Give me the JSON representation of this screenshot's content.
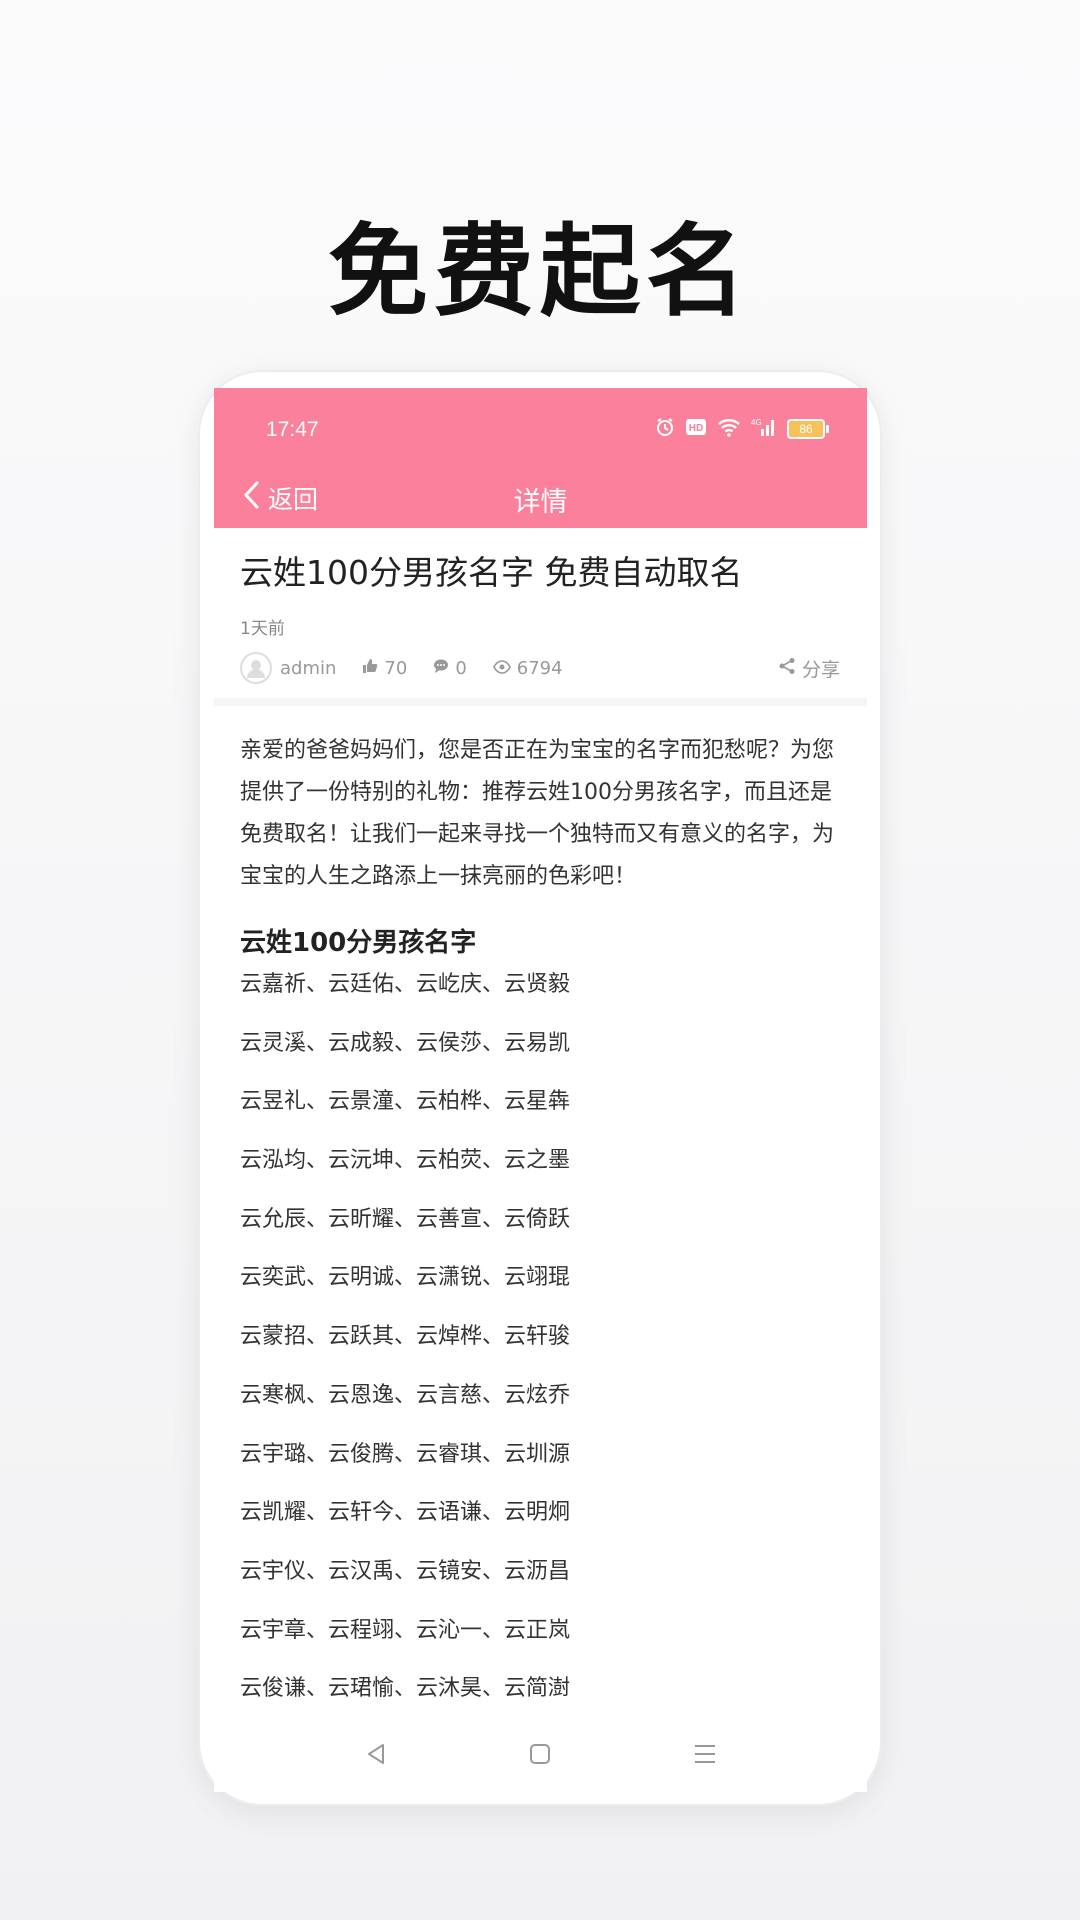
{
  "promo": {
    "title": "免费起名"
  },
  "status_bar": {
    "time": "17:47",
    "battery": "86"
  },
  "navbar": {
    "back_label": "返回",
    "title": "详情"
  },
  "article": {
    "title": "云姓100分男孩名字 免费自动取名",
    "time": "1天前",
    "author": "admin",
    "likes": "70",
    "comments": "0",
    "views": "6794",
    "share_label": "分享",
    "intro": "亲爱的爸爸妈妈们，您是否正在为宝宝的名字而犯愁呢？为您提供了一份特别的礼物：推荐云姓100分男孩名字，而且还是免费取名！让我们一起来寻找一个独特而又有意义的名字，为宝宝的人生之路添上一抹亮丽的色彩吧！",
    "section_heading": "云姓100分男孩名字",
    "names": [
      "云嘉祈、云廷佑、云屹庆、云贤毅",
      "云灵溪、云成毅、云侯莎、云易凯",
      "云昱礼、云景潼、云柏桦、云星犇",
      "云泓均、云沅坤、云柏荧、云之墨",
      "云允辰、云昕耀、云善宣、云倚跃",
      "云奕武、云明诚、云潇锐、云翊琨",
      "云蒙招、云跃其、云焯桦、云轩骏",
      "云寒枫、云恩逸、云言慈、云炫乔",
      "云宇璐、云俊腾、云睿琪、云圳源",
      "云凯耀、云轩今、云语谦、云明炯",
      "云宇仪、云汉禹、云镜安、云沥昌",
      "云宇章、云程翊、云沁一、云正岚",
      "云俊谦、云珺愉、云沐昊、云简澍"
    ]
  },
  "colors": {
    "accent": "#fb809c"
  },
  "icons": [
    "back-chevron-icon",
    "alarm-icon",
    "hd-icon",
    "wifi-icon",
    "signal-icon",
    "battery-icon",
    "avatar-icon",
    "thumbs-up-icon",
    "comment-icon",
    "eye-icon",
    "share-icon",
    "back-triangle-icon",
    "home-square-icon",
    "menu-lines-icon"
  ]
}
